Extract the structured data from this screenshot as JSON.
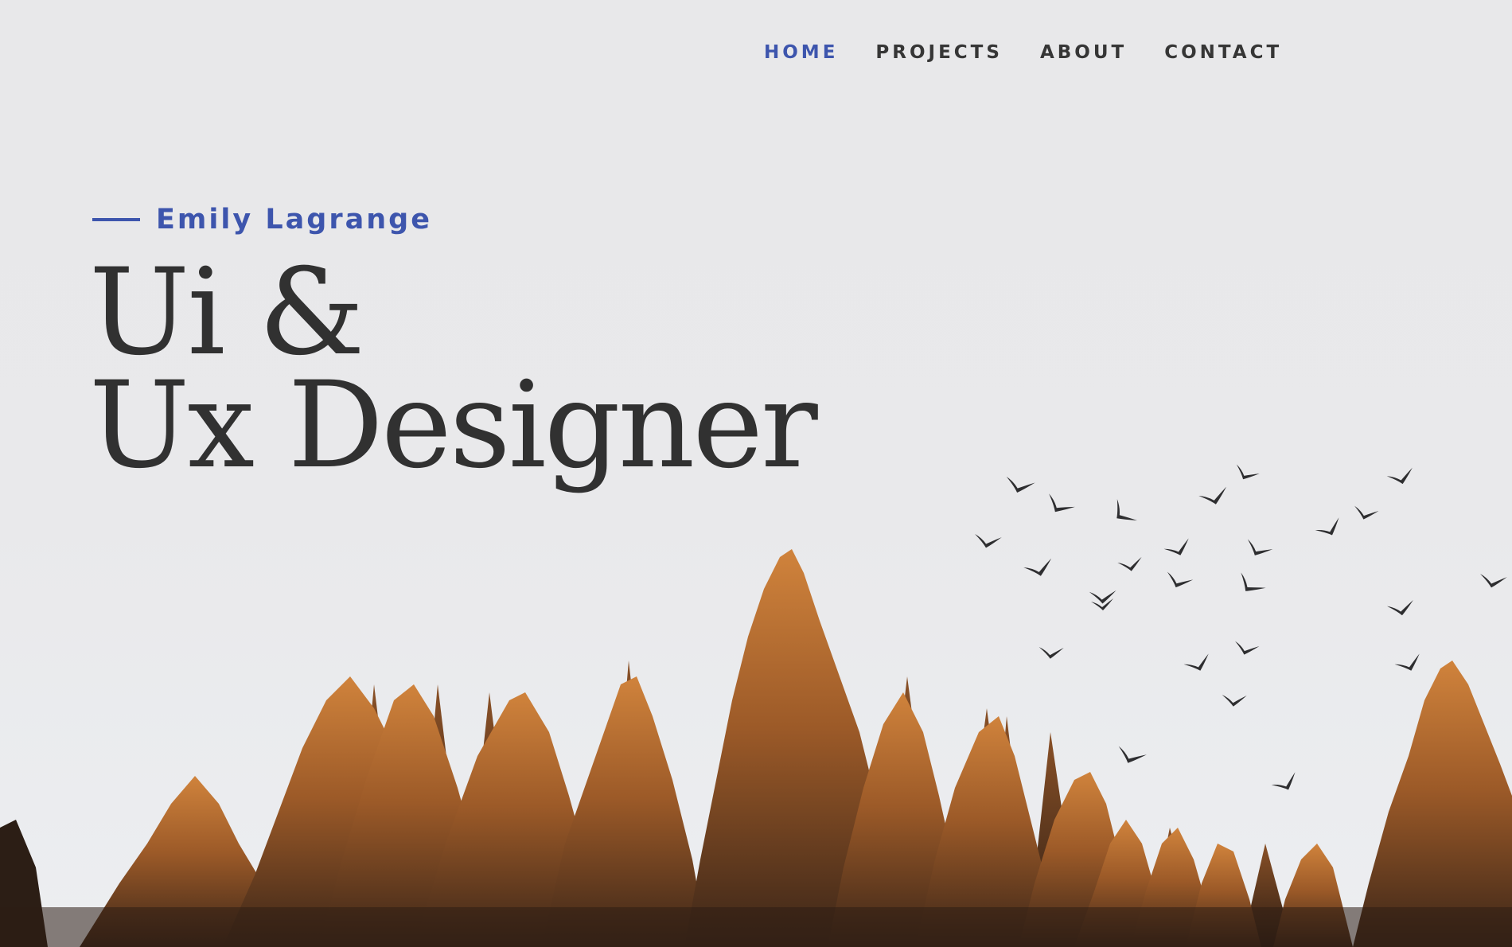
{
  "nav": {
    "items": [
      {
        "label": "HOME",
        "active": true
      },
      {
        "label": "PROJECTS",
        "active": false
      },
      {
        "label": "ABOUT",
        "active": false
      },
      {
        "label": "CONTACT",
        "active": false
      }
    ]
  },
  "hero": {
    "eyebrow": "Emily Lagrange",
    "headline_line1": "Ui &",
    "headline_line2": "Ux Designer"
  },
  "colors": {
    "accent": "#3d55ad",
    "text": "#313131",
    "background": "#e8e8ea",
    "tree_orange": "#c87a38",
    "tree_dark": "#3b2a1e"
  },
  "background_image": "forest-with-birds-photo"
}
